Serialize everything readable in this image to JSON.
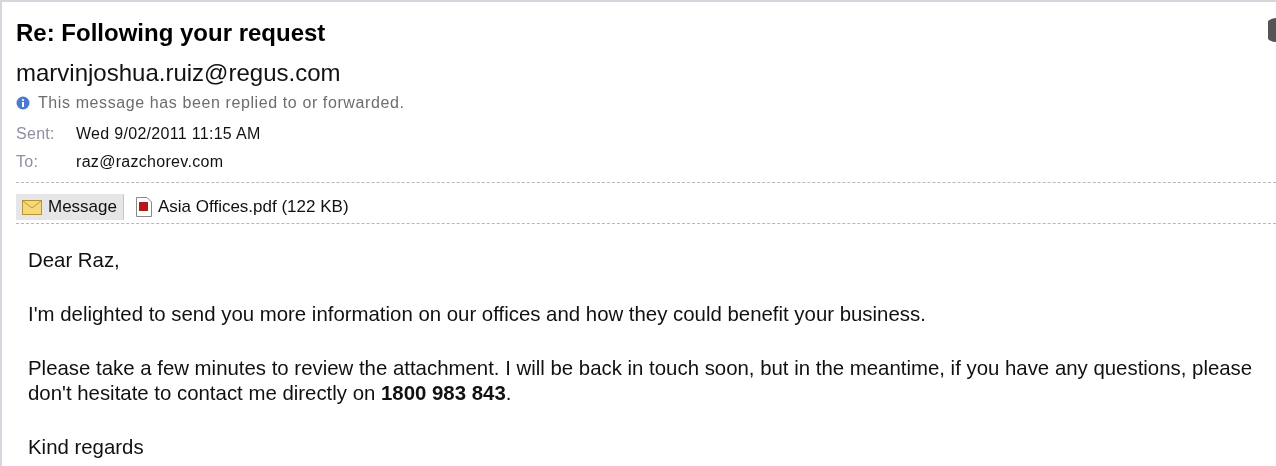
{
  "subject": "Re: Following your request",
  "sender": "marvinjoshua.ruiz@regus.com",
  "info": "This message has been replied to or forwarded.",
  "fields": [
    {
      "label": "Sent:",
      "value": "Wed 9/02/2011 11:15 AM"
    },
    {
      "label": "To:",
      "value": "raz@razchorev.com"
    }
  ],
  "tabs": [
    {
      "kind": "message",
      "label": "Message",
      "selected": true
    },
    {
      "kind": "pdf",
      "label": "Asia Offices.pdf (122 KB)",
      "selected": false
    }
  ],
  "body": [
    "Dear Raz,",
    "I'm delighted to send you more information on our offices and how they could benefit your business.",
    "Please take a few minutes to review the attachment. I will be back in touch soon, but in the meantime, if you have any questions, please don't hesitate to contact me directly on **1800 983 843**.",
    "Kind regards"
  ]
}
